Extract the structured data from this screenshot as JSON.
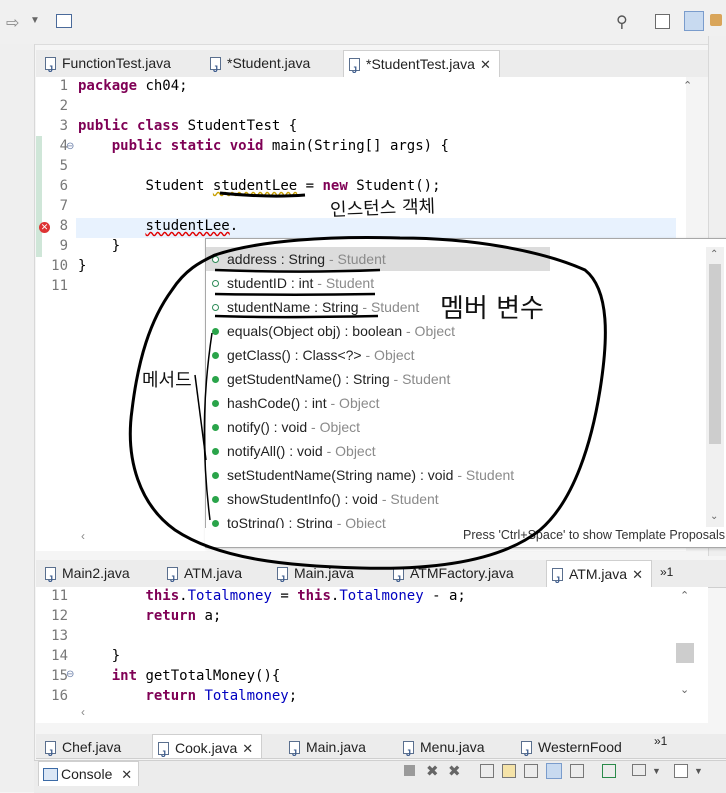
{
  "editor_tabs": [
    {
      "label": "FunctionTest.java",
      "active": false
    },
    {
      "label": "*Student.java",
      "active": false
    },
    {
      "label": "*StudentTest.java",
      "active": true
    }
  ],
  "editor1": {
    "lines": [
      {
        "n": "1",
        "code": "package ch04;"
      },
      {
        "n": "2",
        "code": ""
      },
      {
        "n": "3",
        "code": "public class StudentTest {"
      },
      {
        "n": "4",
        "code": "    public static void main(String[] args) {"
      },
      {
        "n": "5",
        "code": ""
      },
      {
        "n": "6",
        "code": "        Student studentLee = new Student();"
      },
      {
        "n": "7",
        "code": ""
      },
      {
        "n": "8",
        "code": "        studentLee."
      },
      {
        "n": "9",
        "code": "    }"
      },
      {
        "n": "10",
        "code": "}"
      },
      {
        "n": "11",
        "code": ""
      }
    ]
  },
  "content_assist": {
    "items": [
      {
        "kind": "field",
        "sig": "address : String",
        "owner": " - Student",
        "selected": true
      },
      {
        "kind": "field",
        "sig": "studentID : int",
        "owner": " - Student"
      },
      {
        "kind": "field",
        "sig": "studentName : String",
        "owner": " - Student"
      },
      {
        "kind": "method",
        "sig": "equals(Object obj) : boolean",
        "owner": " - Object"
      },
      {
        "kind": "method",
        "sig": "getClass() : Class<?>",
        "owner": " - Object"
      },
      {
        "kind": "method",
        "sig": "getStudentName() : String",
        "owner": " - Student"
      },
      {
        "kind": "method",
        "sig": "hashCode() : int",
        "owner": " - Object"
      },
      {
        "kind": "method",
        "sig": "notify() : void",
        "owner": " - Object"
      },
      {
        "kind": "method",
        "sig": "notifyAll() : void",
        "owner": " - Object"
      },
      {
        "kind": "method",
        "sig": "setStudentName(String name) : void",
        "owner": " - Student"
      },
      {
        "kind": "method",
        "sig": "showStudentInfo() : void",
        "owner": " - Student"
      },
      {
        "kind": "method",
        "sig": "toString() : String",
        "owner": " - Object"
      }
    ],
    "footer": "Press 'Ctrl+Space' to show Template Proposals"
  },
  "editor2_tabs": [
    {
      "label": "Main2.java",
      "active": false
    },
    {
      "label": "ATM.java",
      "active": false
    },
    {
      "label": "Main.java",
      "active": false
    },
    {
      "label": "ATMFactory.java",
      "active": false
    },
    {
      "label": "ATM.java",
      "active": true
    }
  ],
  "editor2_overflow": "»1",
  "editor2": {
    "lines": [
      {
        "n": "11",
        "code": "        this.Totalmoney = this.Totalmoney - a;"
      },
      {
        "n": "12",
        "code": "        return a;"
      },
      {
        "n": "13",
        "code": ""
      },
      {
        "n": "14",
        "code": "    }"
      },
      {
        "n": "15",
        "code": "    int getTotalMoney(){"
      },
      {
        "n": "16",
        "code": "        return Totalmoney;"
      }
    ]
  },
  "editor3_tabs": [
    {
      "label": "Chef.java",
      "active": false
    },
    {
      "label": "Cook.java",
      "active": true
    },
    {
      "label": "Main.java",
      "active": false
    },
    {
      "label": "Menu.java",
      "active": false
    },
    {
      "label": "WesternFood",
      "active": false
    }
  ],
  "editor3_overflow": "»1",
  "console": {
    "tab_label": "Console"
  },
  "handwriting": {
    "instance": "인스턴스 객체",
    "member_var": "멤버 변수",
    "method": "메서드"
  }
}
